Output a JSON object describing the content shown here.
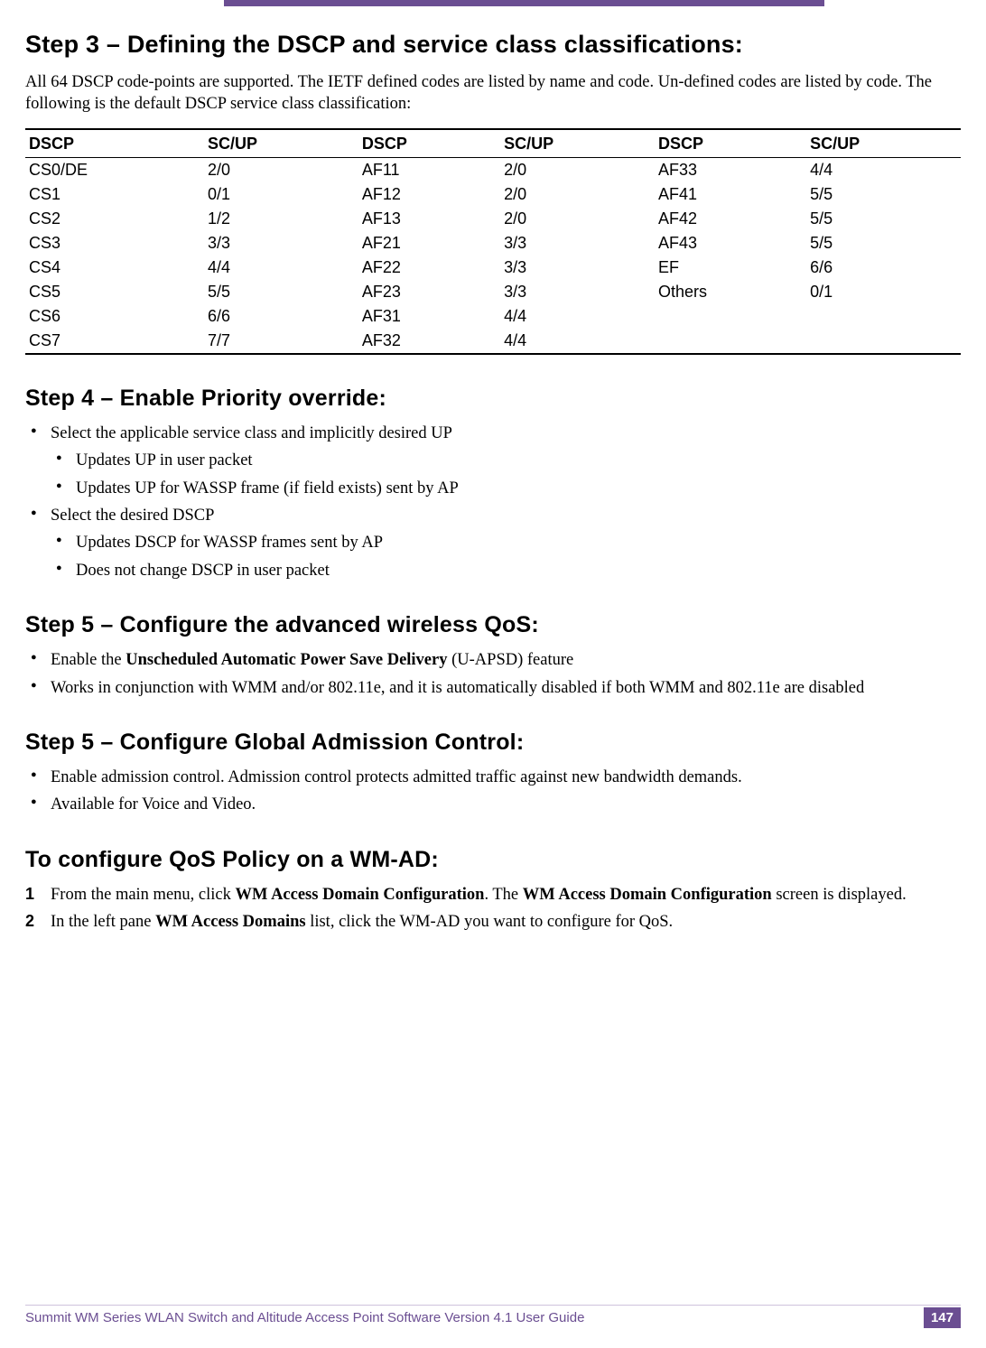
{
  "step3": {
    "heading": "Step 3 – Defining the DSCP and service class classifications:",
    "intro": "All 64 DSCP code-points are supported. The IETF defined codes are listed by name and code. Un-defined codes are listed by code. The following is the default DSCP service class classification:",
    "headers": [
      "DSCP",
      "SC/UP",
      "DSCP",
      "SC/UP",
      "DSCP",
      "SC/UP"
    ],
    "rows": [
      [
        "CS0/DE",
        "2/0",
        "AF11",
        "2/0",
        "AF33",
        "4/4"
      ],
      [
        "CS1",
        "0/1",
        "AF12",
        "2/0",
        "AF41",
        "5/5"
      ],
      [
        "CS2",
        "1/2",
        "AF13",
        "2/0",
        "AF42",
        "5/5"
      ],
      [
        "CS3",
        "3/3",
        "AF21",
        "3/3",
        "AF43",
        "5/5"
      ],
      [
        "CS4",
        "4/4",
        "AF22",
        "3/3",
        "EF",
        "6/6"
      ],
      [
        "CS5",
        "5/5",
        "AF23",
        "3/3",
        "Others",
        "0/1"
      ],
      [
        "CS6",
        "6/6",
        "AF31",
        "4/4",
        "",
        ""
      ],
      [
        "CS7",
        "7/7",
        "AF32",
        "4/4",
        "",
        ""
      ]
    ]
  },
  "step4": {
    "heading": "Step 4 – Enable Priority override:",
    "bullets": [
      {
        "text": "Select the applicable service class and implicitly desired UP",
        "sub": [
          "Updates UP in user packet",
          "Updates UP for WASSP frame (if field exists) sent by AP"
        ]
      },
      {
        "text": "Select the desired DSCP",
        "sub": [
          "Updates DSCP for WASSP frames sent by AP",
          "Does not change DSCP in user packet"
        ]
      }
    ]
  },
  "step5a": {
    "heading": "Step 5 – Configure the advanced wireless QoS:",
    "bullets": [
      {
        "prefix": "Enable the ",
        "bold": "Unscheduled Automatic Power Save Delivery",
        "suffix": " (U-APSD) feature"
      },
      {
        "text": "Works in conjunction with WMM and/or 802.11e, and it is automatically disabled if both WMM and 802.11e are disabled"
      }
    ]
  },
  "step5b": {
    "heading": "Step 5 – Configure Global Admission Control:",
    "bullets": [
      "Enable admission control. Admission control protects admitted traffic against new bandwidth demands.",
      "Available for Voice and Video."
    ]
  },
  "configure": {
    "heading": "To configure QoS Policy on a WM-AD:",
    "steps": [
      {
        "num": "1",
        "prefix": "From the main menu, click ",
        "bold1": "WM Access Domain Configuration",
        "mid": ". The ",
        "bold2": "WM Access Domain Configuration",
        "suffix": " screen is displayed."
      },
      {
        "num": "2",
        "prefix": "In the left pane ",
        "bold1": "WM Access Domains",
        "mid": " list, click the WM-AD you want to configure for QoS.",
        "bold2": "",
        "suffix": ""
      }
    ]
  },
  "footer": {
    "text": "Summit WM Series WLAN Switch and Altitude Access Point Software Version 4.1 User Guide",
    "page": "147"
  }
}
